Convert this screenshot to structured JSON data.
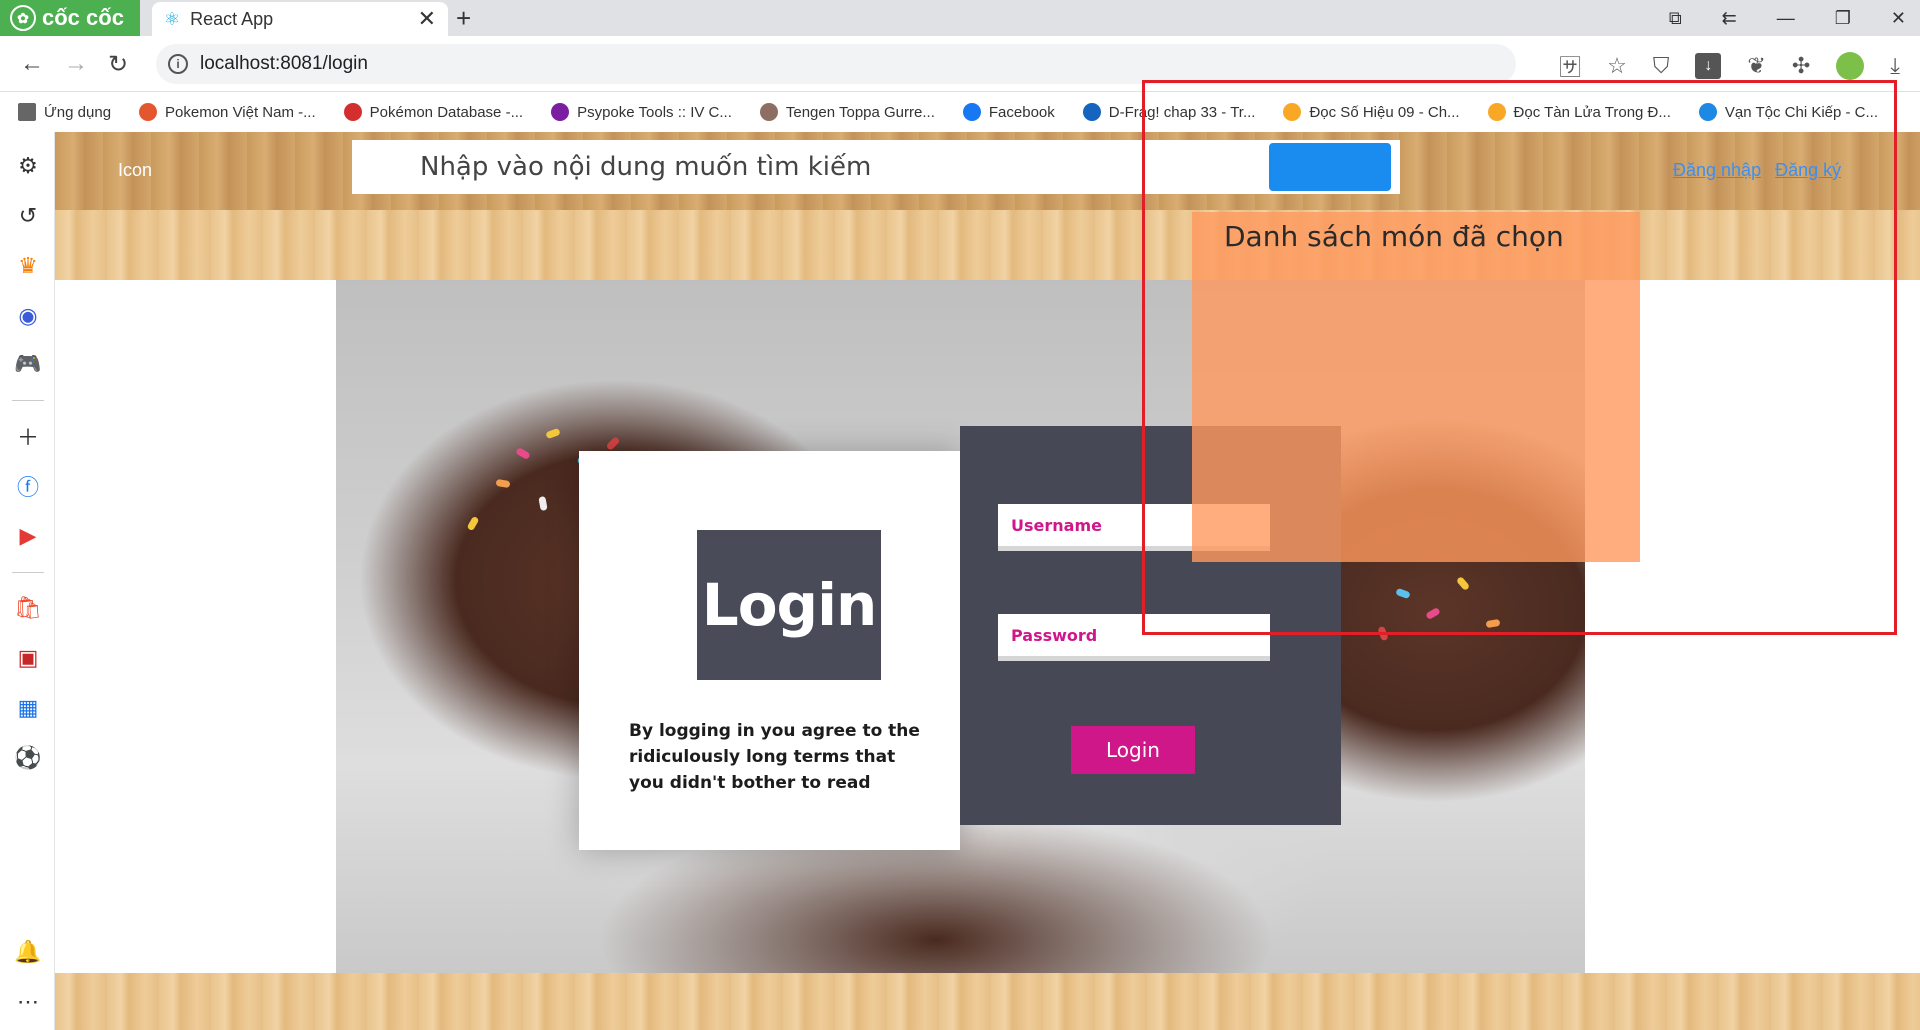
{
  "browser": {
    "brand_name": "cốc cốc",
    "tab_title": "React App",
    "url": "localhost:8081/login",
    "bookmarks": [
      {
        "label": "Ứng dụng",
        "color": "#666666"
      },
      {
        "label": "Pokemon Việt Nam -...",
        "color": "#e4572e"
      },
      {
        "label": "Pokémon Database -...",
        "color": "#d32f2f"
      },
      {
        "label": "Psypoke Tools :: IV C...",
        "color": "#7b1fa2"
      },
      {
        "label": "Tengen Toppa Gurre...",
        "color": "#8d6e63"
      },
      {
        "label": "Facebook",
        "color": "#1877f2"
      },
      {
        "label": "D-Frag! chap 33 - Tr...",
        "color": "#1565c0"
      },
      {
        "label": "Đọc Số Hiệu 09 - Ch...",
        "color": "#f9a825"
      },
      {
        "label": "Đọc Tàn Lửa Trong Đ...",
        "color": "#f9a825"
      },
      {
        "label": "Vạn Tộc Chi Kiếp - C...",
        "color": "#1e88e5"
      }
    ]
  },
  "page": {
    "site_icon_label": "Icon",
    "search_placeholder": "Nhập vào nội dung muốn tìm kiếm",
    "login_link": "Đăng nhập",
    "register_link": "Đăng ký",
    "cart_title": "Danh sách món đã chọn",
    "login_badge": "Login",
    "terms_text": "By logging in you agree to the ridiculously long terms that you didn't bother to read",
    "username_placeholder": "Username",
    "password_placeholder": "Password",
    "login_button": "Login"
  },
  "colors": {
    "accent_magenta": "#d0178a",
    "panel_dark": "#464856",
    "cart_orange": "#ff995e",
    "search_button_blue": "#1a8cf0",
    "annotation_red": "#e21f26"
  }
}
